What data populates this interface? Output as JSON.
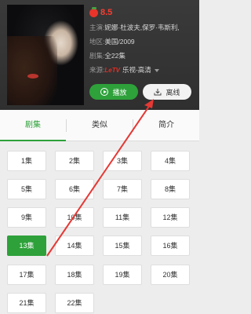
{
  "show": {
    "score": "8.5",
    "cast_label": "主演:",
    "cast_value": "妮娜·杜波夫,保罗·韦斯利,",
    "region_label": "地区:",
    "region_value": "美国/2009",
    "episodes_label": "剧集:",
    "episodes_value": "全22集",
    "source_label": "来源:",
    "source_logo": "LeTV",
    "source_value": "乐视-高清"
  },
  "actions": {
    "play_label": "播放",
    "offline_label": "离线"
  },
  "tabs": [
    {
      "label": "剧集",
      "active": true
    },
    {
      "label": "类似",
      "active": false
    },
    {
      "label": "简介",
      "active": false
    }
  ],
  "episodes": [
    "1集",
    "2集",
    "3集",
    "4集",
    "5集",
    "6集",
    "7集",
    "8集",
    "9集",
    "10集",
    "11集",
    "12集",
    "13集",
    "14集",
    "15集",
    "16集",
    "17集",
    "18集",
    "19集",
    "20集",
    "21集",
    "22集"
  ],
  "selected_episode": "13集",
  "colors": {
    "accent": "#2ea13a",
    "score": "#ff3b2f",
    "header_bg": "#333333",
    "annotation_arrow": "#e53935"
  }
}
